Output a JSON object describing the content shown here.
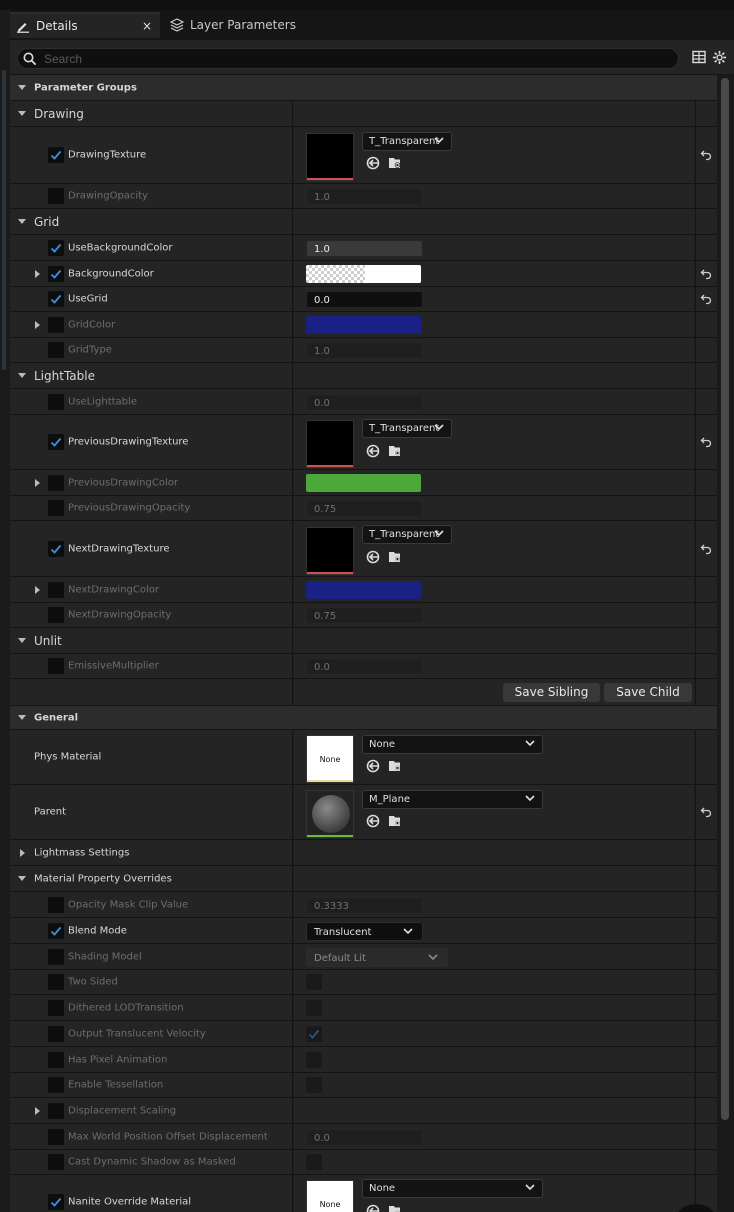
{
  "tabs": {
    "details": {
      "label": "Details",
      "close": "×"
    },
    "layer_parameters": {
      "label": "Layer Parameters"
    }
  },
  "search": {
    "placeholder": "Search"
  },
  "sections": {
    "parameter_groups": "Parameter Groups",
    "drawing": "Drawing",
    "grid": "Grid",
    "lighttable": "LightTable",
    "unlit": "Unlit",
    "general": "General",
    "lightmass_settings": "Lightmass Settings",
    "material_property_overrides": "Material Property Overrides"
  },
  "params": {
    "drawing_texture": {
      "label": "DrawingTexture",
      "asset": "T_Transparent",
      "checked": true
    },
    "drawing_opacity": {
      "label": "DrawingOpacity",
      "value": "1.0",
      "checked": false
    },
    "use_background_color": {
      "label": "UseBackgroundColor",
      "value": "1.0",
      "checked": true
    },
    "background_color": {
      "label": "BackgroundColor",
      "checked": true,
      "color": "#ffffff"
    },
    "use_grid": {
      "label": "UseGrid",
      "value": "0.0",
      "checked": true
    },
    "grid_color": {
      "label": "GridColor",
      "checked": false,
      "color": "#1a2184"
    },
    "grid_type": {
      "label": "GridType",
      "value": "1.0",
      "checked": false
    },
    "use_lighttable": {
      "label": "UseLighttable",
      "value": "0.0",
      "checked": false
    },
    "previous_drawing_texture": {
      "label": "PreviousDrawingTexture",
      "asset": "T_Transparent",
      "checked": true
    },
    "previous_drawing_color": {
      "label": "PreviousDrawingColor",
      "checked": false,
      "color": "#4da83c"
    },
    "previous_drawing_opacity": {
      "label": "PreviousDrawingOpacity",
      "value": "0.75",
      "checked": false
    },
    "next_drawing_texture": {
      "label": "NextDrawingTexture",
      "asset": "T_Transparent",
      "checked": true
    },
    "next_drawing_color": {
      "label": "NextDrawingColor",
      "checked": false,
      "color": "#1a2184"
    },
    "next_drawing_opacity": {
      "label": "NextDrawingOpacity",
      "value": "0.75",
      "checked": false
    },
    "emissive_multiplier": {
      "label": "EmissiveMultiplier",
      "value": "0.0",
      "checked": false
    }
  },
  "buttons": {
    "save_sibling": "Save Sibling",
    "save_child": "Save Child"
  },
  "general": {
    "phys_material": {
      "label": "Phys Material",
      "value": "None",
      "thumb": "None"
    },
    "parent": {
      "label": "Parent",
      "value": "M_Plane"
    }
  },
  "overrides": {
    "opacity_mask_clip_value": {
      "label": "Opacity Mask Clip Value",
      "value": "0.3333",
      "checked": false
    },
    "blend_mode": {
      "label": "Blend Mode",
      "value": "Translucent",
      "checked": true
    },
    "shading_model": {
      "label": "Shading Model",
      "value": "Default Lit",
      "checked": false
    },
    "two_sided": {
      "label": "Two Sided",
      "checked": false
    },
    "dithered_lod": {
      "label": "Dithered LODTransition",
      "checked": false
    },
    "output_translucent_velocity": {
      "label": "Output Translucent Velocity",
      "checked": false,
      "value_checked": true
    },
    "has_pixel_animation": {
      "label": "Has Pixel Animation",
      "checked": false
    },
    "enable_tessellation": {
      "label": "Enable Tessellation",
      "checked": false
    },
    "displacement_scaling": {
      "label": "Displacement Scaling",
      "checked": false
    },
    "max_wpo_displacement": {
      "label": "Max World Position Offset Displacement",
      "value": "0.0",
      "checked": false
    },
    "cast_dynamic_shadow_masked": {
      "label": "Cast Dynamic Shadow as Masked",
      "checked": false
    },
    "nanite_override_material": {
      "label": "Nanite Override Material",
      "value": "None",
      "thumb": "None",
      "checked": true
    }
  }
}
